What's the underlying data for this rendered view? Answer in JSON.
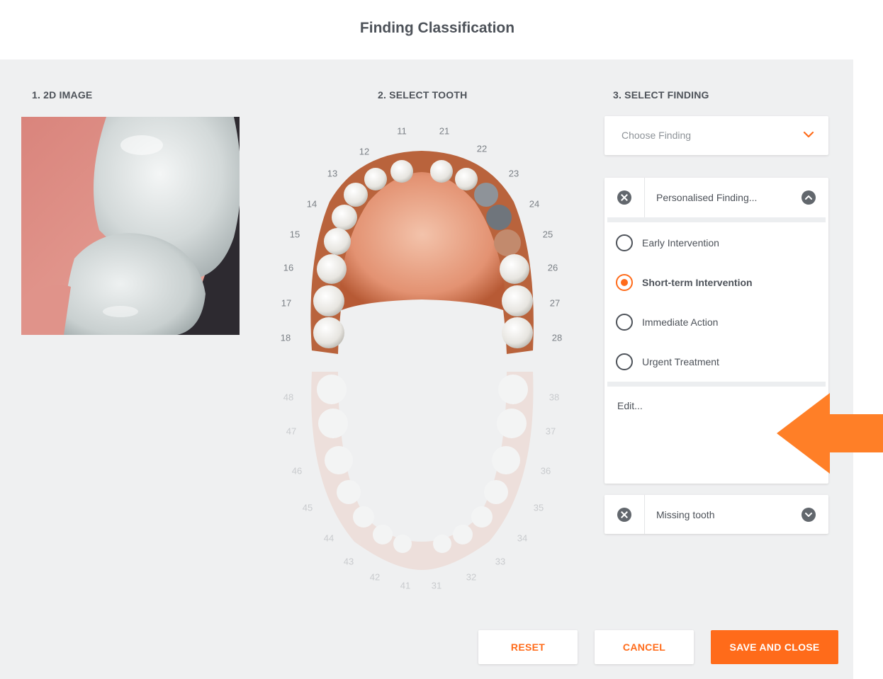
{
  "header": {
    "title": "Finding Classification"
  },
  "sections": {
    "image_label": "1. 2D IMAGE",
    "tooth_label": "2. SELECT TOOTH",
    "finding_label": "3. SELECT FINDING"
  },
  "chart": {
    "upper_numbers": [
      "11",
      "21",
      "12",
      "22",
      "13",
      "23",
      "14",
      "24",
      "15",
      "25",
      "16",
      "26",
      "17",
      "27",
      "18",
      "28"
    ],
    "lower_numbers": [
      "48",
      "38",
      "47",
      "37",
      "46",
      "36",
      "45",
      "35",
      "44",
      "34",
      "43",
      "33",
      "42",
      "32",
      "41",
      "31"
    ]
  },
  "finding": {
    "choose_placeholder": "Choose Finding",
    "personalised": {
      "title": "Personalised Finding...",
      "options": [
        {
          "label": "Early Intervention",
          "selected": false
        },
        {
          "label": "Short-term Intervention",
          "selected": true
        },
        {
          "label": "Immediate Action",
          "selected": false
        },
        {
          "label": "Urgent Treatment",
          "selected": false
        }
      ],
      "edit_label": "Edit..."
    },
    "missing": {
      "title": "Missing tooth"
    }
  },
  "actions": {
    "reset": "RESET",
    "cancel": "CANCEL",
    "save": "SAVE AND CLOSE"
  },
  "colors": {
    "accent": "#ff6b1a",
    "panel_bg": "#eff0f1",
    "text": "#4d5259"
  },
  "icons": [
    "close-icon",
    "chevron-down-icon",
    "chevron-up-icon",
    "arrow-left-icon"
  ]
}
